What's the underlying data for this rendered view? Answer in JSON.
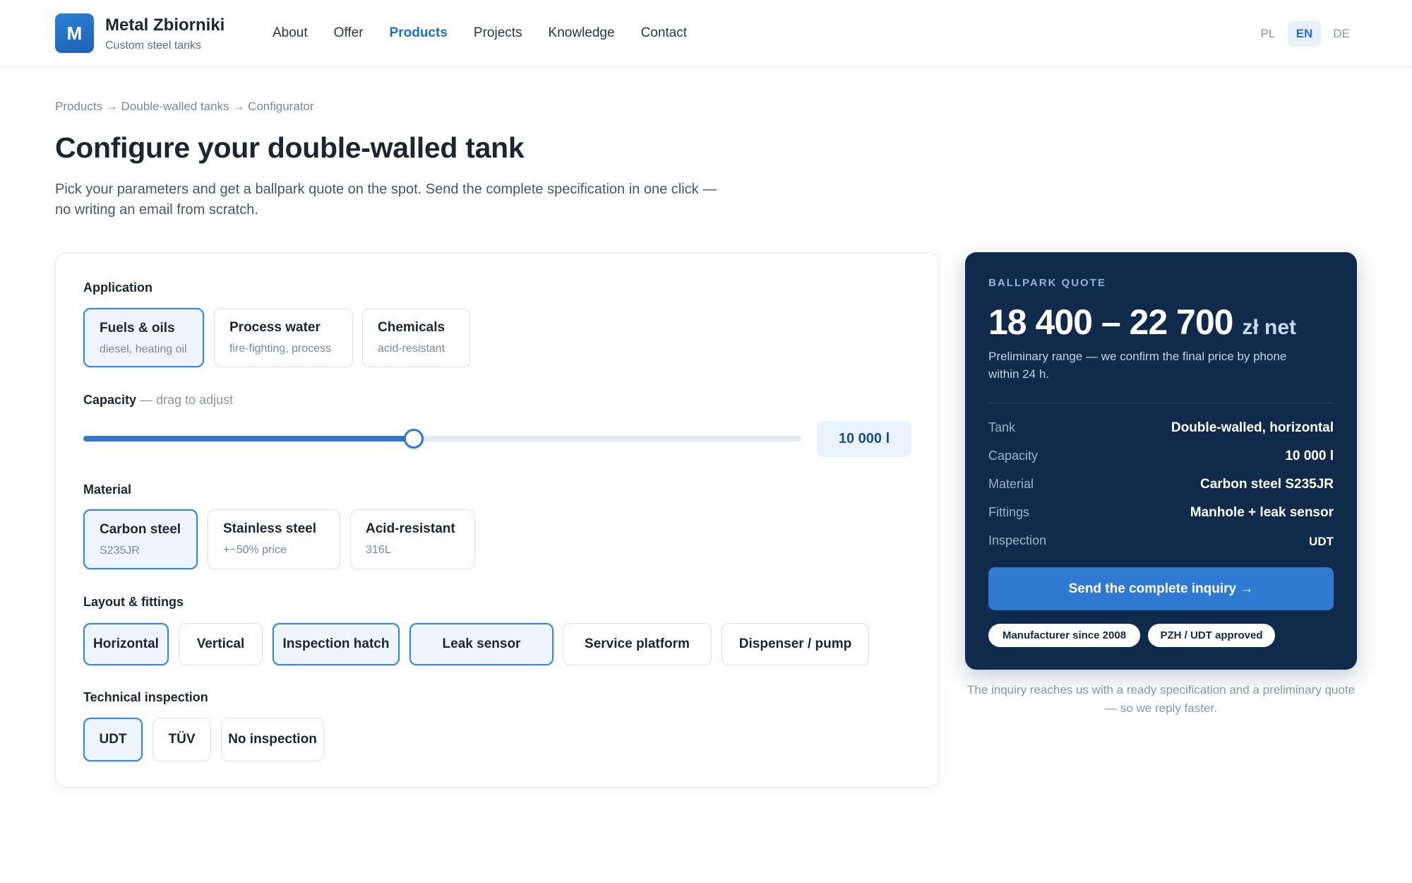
{
  "header": {
    "logo_letter": "M",
    "brand_name": "Metal Zbiorniki",
    "brand_tagline": "Custom steel tanks",
    "nav": [
      "About",
      "Offer",
      "Products",
      "Projects",
      "Knowledge",
      "Contact"
    ],
    "active_nav": "Products",
    "languages": [
      "PL",
      "EN",
      "DE"
    ],
    "active_language": "EN"
  },
  "intro": {
    "breadcrumb": "Products → Double-walled tanks → Configurator",
    "title": "Configure your double-walled tank",
    "lead": "Pick your parameters and get a ballpark quote on the spot. Send the complete specification in one click — no writing an email from scratch."
  },
  "config": {
    "application": {
      "label": "Application",
      "options": [
        {
          "title": "Fuels & oils",
          "sub": "diesel, heating oil",
          "selected": true
        },
        {
          "title": "Process water",
          "sub": "fire-fighting, process",
          "selected": false
        },
        {
          "title": "Chemicals",
          "sub": "acid-resistant",
          "selected": false
        }
      ]
    },
    "capacity": {
      "label": "Capacity",
      "hint": "— drag to adjust",
      "value_text": "10 000 l",
      "level": 0.46
    },
    "material": {
      "label": "Material",
      "options": [
        {
          "title": "Carbon steel",
          "sub": "S235JR",
          "selected": true
        },
        {
          "title": "Stainless steel",
          "sub": "+~50% price",
          "selected": false
        },
        {
          "title": "Acid-resistant",
          "sub": "316L",
          "selected": false
        }
      ]
    },
    "layout": {
      "label": "Layout & fittings",
      "options": [
        {
          "title": "Horizontal",
          "selected": true
        },
        {
          "title": "Vertical",
          "selected": false
        },
        {
          "title": "Inspection hatch",
          "selected": true
        },
        {
          "title": "Leak sensor",
          "selected": true
        },
        {
          "title": "Service platform",
          "selected": false
        },
        {
          "title": "Dispenser / pump",
          "selected": false
        }
      ]
    },
    "inspection": {
      "label": "Technical inspection",
      "options": [
        {
          "title": "UDT",
          "selected": true
        },
        {
          "title": "TÜV",
          "selected": false
        },
        {
          "title": "No inspection",
          "selected": false
        }
      ]
    }
  },
  "quote": {
    "kicker": "BALLPARK QUOTE",
    "range": "18 400 – 22 700",
    "unit": "zł net",
    "note": "Preliminary range — we confirm the final price by phone within 24 h.",
    "specs": [
      {
        "label": "Tank",
        "value": "Double-walled, horizontal"
      },
      {
        "label": "Capacity",
        "value": "10 000 l"
      },
      {
        "label": "Material",
        "value": "Carbon steel S235JR"
      },
      {
        "label": "Fittings",
        "value": "Manhole + leak sensor"
      },
      {
        "label": "Inspection",
        "value": "UDT"
      }
    ],
    "button": "Send the complete inquiry →",
    "badges": [
      "Manufacturer since 2008",
      "PZH / UDT approved"
    ],
    "footnote": "The inquiry reaches us with a ready specification and a preliminary quote — so we reply faster."
  },
  "colors": {
    "accent": "#2f7ad0",
    "quote_background": "#0f2a4a",
    "selected_background": "#eef5fd"
  }
}
